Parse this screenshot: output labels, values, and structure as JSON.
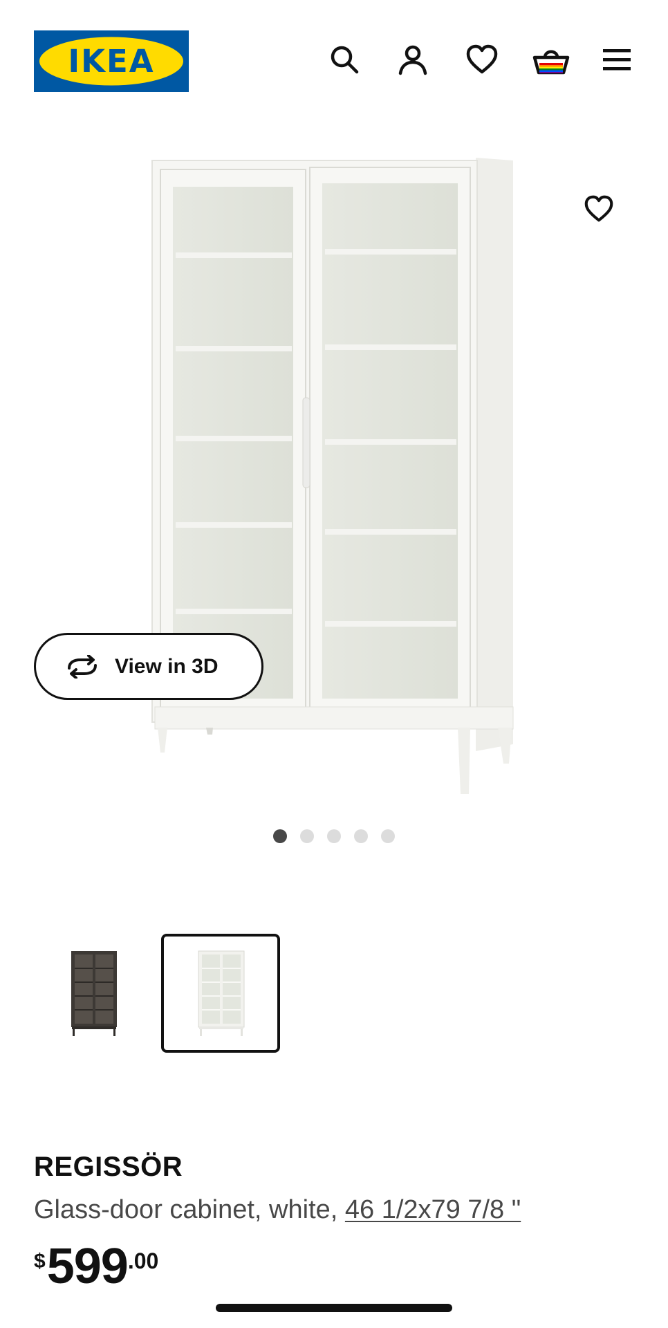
{
  "header": {
    "logo_text": "IKEA",
    "logo_colors": {
      "blue": "#0058A3",
      "yellow": "#FFDB00"
    },
    "icons": [
      "search-icon",
      "account-icon",
      "favorites-icon",
      "cart-icon",
      "menu-icon"
    ]
  },
  "gallery": {
    "view_3d_label": "View in 3D",
    "dots_total": 5,
    "active_dot": 1,
    "favorite_icon": "heart-outline-icon"
  },
  "variants": [
    {
      "color": "dark-brown",
      "selected": false
    },
    {
      "color": "white",
      "selected": true
    }
  ],
  "product": {
    "name": "REGISSÖR",
    "description": "Glass-door cabinet, white, ",
    "size_link": "46 1/2x79 7/8 \"",
    "price": {
      "currency": "$",
      "whole": "599",
      "cents": ".00"
    }
  },
  "colors": {
    "text": "#111111",
    "muted": "#484848",
    "dot_inactive": "#dcdcdc",
    "dot_active": "#484848"
  }
}
